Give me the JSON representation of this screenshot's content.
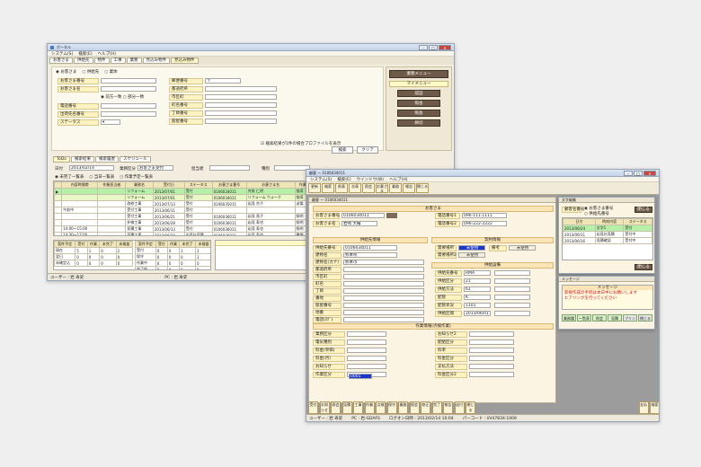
{
  "main_window": {
    "title": "ポータル",
    "menu": [
      "システム(S)",
      "検索(E)",
      "ヘルプ(H)"
    ],
    "tabs": [
      "お客さま",
      "供給先",
      "物件",
      "工事",
      "業務",
      "見込み物件",
      "見込み物件"
    ],
    "radio": [
      "お客さま",
      "供給先",
      "業体"
    ],
    "search_fields_left": [
      "お客さま番号",
      "お客さま名",
      "",
      "電話番号",
      "出荷先名番号",
      "ステータス"
    ],
    "search_fields_right": [
      "郵便番号",
      "都道府県",
      "市区町",
      "町名番号",
      "丁目番号",
      "部屋番号"
    ],
    "right_panel": {
      "header1": "業務メニュー",
      "header2": "マイメニュー",
      "buttons": [
        "認証",
        "照会",
        "照会",
        "締切"
      ]
    },
    "checkbox_label": "検索結果が1件の場合プロファイルを表示",
    "search_button": "検索",
    "clear_button": "クリア",
    "lower_tabs": [
      "ToDo",
      "検索結果",
      "検索履歴",
      "スケジュール"
    ],
    "date_label": "日付",
    "date_value": "2013/02/14",
    "category_label": "業務区分",
    "category_value": "お客さま受付",
    "staff_label": "担当者",
    "type_label": "種別",
    "subtabs": [
      "未完了一覧表",
      "当日一覧表",
      "作業予定一覧表"
    ],
    "table_headers": [
      "",
      "内容時間帯",
      "作業担当者",
      "業務名",
      "受付日",
      "ステータス",
      "お客さま番号",
      "お客さま名",
      "作業内容"
    ],
    "table_rows": [
      [
        "▶",
        "",
        "",
        "リフォーム",
        "2013/07/01",
        "受付",
        "0106034011",
        "共栄 仁明",
        "指導"
      ],
      [
        "",
        "",
        "",
        "リフォーム",
        "2013/07/01",
        "受付",
        "0106034011",
        "リフォーム ウォーク",
        "指導"
      ],
      [
        "",
        "",
        "",
        "改修工事",
        "2013/07/13",
        "受付",
        "0106035011",
        "岩見 京子",
        "送電"
      ],
      [
        "",
        "午前中",
        "",
        "受付工事",
        "2013/06/11",
        "受付",
        "",
        "",
        ""
      ],
      [
        "",
        "",
        "",
        "受付工事",
        "2013/06/21",
        "受付",
        "0106036011",
        "岩見 直子",
        "照明"
      ],
      [
        "",
        "",
        "",
        "外線工事",
        "2013/06/28",
        "受付",
        "0106036011",
        "岩見 寿也",
        "照明"
      ],
      [
        "",
        "14:00〜15:00",
        "",
        "見積工事",
        "2013/06/13",
        "受付",
        "0106036011",
        "岩見 寿也",
        "照明"
      ],
      [
        "",
        "14:30〜17:00",
        "",
        "見積工事",
        "2013/06/28",
        "岩見社見積",
        "0106036011",
        "岩見 寿也",
        "書類"
      ],
      [
        "",
        "午前〜午後",
        "竹本 宜",
        "内装工事",
        "2013/06/30",
        "受付",
        "0106036011",
        "岩見 寿也",
        "照明"
      ],
      [
        "",
        "午前",
        "",
        "外装工事",
        "2013/05/10",
        "受付",
        "",
        "",
        "照明"
      ]
    ],
    "sum_headers_a": [
      "案件予定",
      "受付",
      "作業",
      "未完了",
      "未検査"
    ],
    "sum_rows_a": [
      [
        "現在",
        "5",
        "1",
        "0",
        "2"
      ],
      [
        "翌日",
        "0",
        "0",
        "0",
        "0"
      ],
      [
        "未確定込",
        "0",
        "0",
        "0",
        "0"
      ]
    ],
    "sum_headers_b": [
      "案件予定",
      "受付",
      "作業",
      "未完了",
      "未検査"
    ],
    "sum_rows_b": [
      [
        "受付",
        "0",
        "0",
        "1",
        "1"
      ],
      [
        "保守",
        "0",
        "0",
        "0",
        "1"
      ],
      [
        "作業中",
        "0",
        "0",
        "0",
        "0"
      ],
      [
        "完了前",
        "0",
        "0",
        "0",
        "0"
      ]
    ],
    "notice_label": "お知らせ",
    "status": [
      "ユーザー : 岩 寿史",
      "PC : 岩 寿史",
      "ログオン日時 : 2013/02/14 10:04"
    ]
  },
  "detail_window": {
    "title": "顧客 ー 0106034011",
    "menu": [
      "システム(S)",
      "検索(E)",
      "ウインドウ(W)",
      "ヘルプ(H)"
    ],
    "toolbar": [
      "更新",
      "検索",
      "前表",
      "次表",
      "照会",
      "お客さま",
      "業務",
      "報告",
      "閉じる"
    ],
    "customer_header": "お客さま",
    "customer_number_label": "お客さま番号",
    "customer_number": "0106034011",
    "customer_name_label": "お客さま名",
    "customer_name": "岩崎 大輔",
    "phone_labels": [
      "電話番号1",
      "電話番号2"
    ],
    "phone_values": [
      "096-111-1111",
      "096-222-2222"
    ],
    "supply_header": "供給先情報",
    "supply_fields": [
      "供給先番号",
      "建物名",
      "建物名(カナ)",
      "都道府県",
      "市区町",
      "町名",
      "丁目",
      "番地",
      "部屋番号",
      "地番",
      "電話(ﾛｸﾞ)"
    ],
    "supply_values": [
      "0106034011",
      "熊本県",
      "熊本市",
      "",
      "",
      "",
      "",
      "",
      "",
      "",
      ""
    ],
    "contract_header": "契約情報",
    "contract_labels": [
      "需要場所",
      "需要場所2",
      "備考"
    ],
    "contract_values": [
      "未使用",
      "未使用",
      "未使用"
    ],
    "gas_header": "供給設備",
    "gas_fields": [
      "供給先番号",
      "供給区分",
      "供給方法",
      "配管",
      "配管状況",
      "供給区間"
    ],
    "gas_values": [
      "RMA",
      "21",
      "61",
      "K",
      "1101",
      "2013/06/01"
    ],
    "work_header": "作業情報(点検作業)",
    "work_fields": [
      "業務区分",
      "電気種別",
      "料金(単価)",
      "料金(月)",
      "お知らせ",
      "作業区分",
      "お知らせ2",
      "配給区分",
      "料率",
      "料金区分",
      "支払方法",
      "料金区分2"
    ],
    "work_values": [
      "新規",
      "",
      ""
    ],
    "work_highlight": "0001",
    "side_buttons": [
      "主要業務",
      "照会業務",
      "照会業務",
      "送付先"
    ],
    "footer_buttons": [
      "受付",
      "お知らせ",
      "照会",
      "見積",
      "工事",
      "作業",
      "点検",
      "保守",
      "業務",
      "照会",
      "修正",
      "完了",
      "報告",
      "送付",
      "閉じる",
      "支払",
      "検索"
    ],
    "status": [
      "ユーザー : 岩 寿史",
      "PC : 岩-GDAFS",
      "ログオン日時 : 2013/02/14 10:04",
      "パーコード : I/V4783X-1009"
    ]
  },
  "sub_window1": {
    "title": "文字編集",
    "left_label": "顧客名番号",
    "radio": [
      "お客さま番号",
      "供給先番号"
    ],
    "close_button": "閉じる",
    "headers": [
      "日付",
      "時刻内容",
      "ステータス"
    ],
    "rows": [
      [
        "2013/06/24",
        "文字1",
        "受付"
      ],
      [
        "2013/06/11",
        "岩見社見積",
        "受付中"
      ],
      [
        "2013/06/16",
        "見積確認",
        "受付中"
      ]
    ],
    "bottom_button": "閉じる"
  },
  "sub_window2": {
    "title": "メッセージ",
    "alert_header": "メッセージ",
    "alert_lines": [
      "新規作成の手続は本日中にお願いします",
      "ヒアリングを行ってください"
    ],
    "buttons": [
      "業務履歴",
      "一覧表示",
      "照会",
      "見積",
      "プリント",
      "閉じる"
    ]
  }
}
